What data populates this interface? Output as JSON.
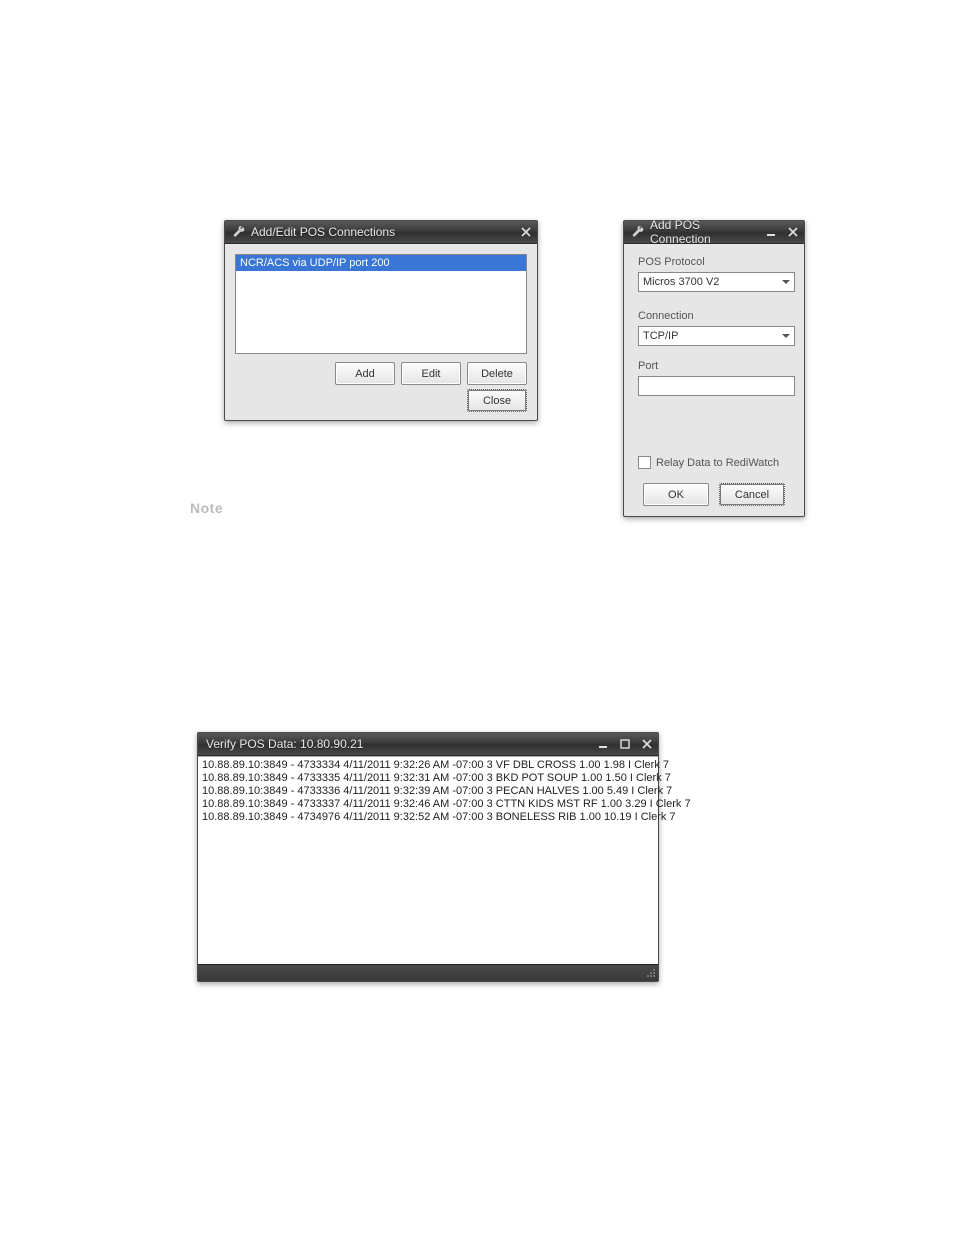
{
  "dlg1": {
    "title": "Add/Edit POS Connections",
    "list_item": "NCR/ACS via UDP/IP port 200",
    "buttons": {
      "add": "Add",
      "edit": "Edit",
      "delete": "Delete",
      "close": "Close"
    }
  },
  "dlg2": {
    "title": "Add POS Connection",
    "labels": {
      "protocol": "POS Protocol",
      "connection": "Connection",
      "port": "Port",
      "relay": "Relay Data to RediWatch"
    },
    "values": {
      "protocol": "Micros 3700 V2",
      "connection": "TCP/IP",
      "port": ""
    },
    "buttons": {
      "ok": "OK",
      "cancel": "Cancel"
    }
  },
  "note": "Note",
  "verify": {
    "title": "Verify POS Data: 10.80.90.21",
    "lines": [
      "10.88.89.10:3849 - 4733334 4/11/2011 9:32:26 AM -07:00 3 VF DBL CROSS 1.00 1.98 I Clerk 7",
      "10.88.89.10:3849 - 4733335 4/11/2011 9:32:31 AM -07:00 3 BKD POT SOUP 1.00 1.50 I Clerk 7",
      "10.88.89.10:3849 - 4733336 4/11/2011 9:32:39 AM -07:00 3 PECAN HALVES 1.00 5.49 I Clerk 7",
      "10.88.89.10:3849 - 4733337 4/11/2011 9:32:46 AM -07:00 3 CTTN KIDS MST RF 1.00 3.29 I Clerk 7",
      "10.88.89.10:3849 - 4734976 4/11/2011 9:32:52 AM -07:00 3 BONELESS RIB 1.00 10.19 I Clerk 7"
    ]
  }
}
